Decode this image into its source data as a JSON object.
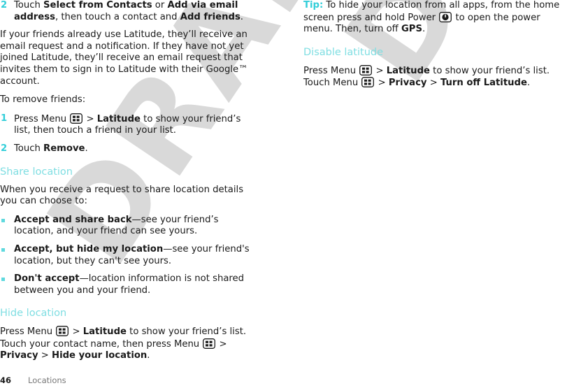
{
  "watermark": {
    "line1": "DRAFT",
    "line2": "DRAFT",
    "color": "#d9d9d9"
  },
  "colors": {
    "heading": "#7fdee2",
    "tip_label": "#32ced9",
    "list_marker": "#32ced9",
    "bullet": "#5fd9de",
    "body_text": "#1a1a1a",
    "footer_chapter": "#777777"
  },
  "icons": {
    "menu": "menu-key-icon",
    "power": "power-key-icon"
  },
  "left_column": {
    "step2": {
      "number": "2",
      "t1": "Touch ",
      "b1": "Select from Contacts",
      "t2": " or ",
      "b2": "Add via email address",
      "t3": ", then touch a contact and ",
      "b3": "Add friends",
      "t4": "."
    },
    "para_latitude_friends": "If your friends already use Latitude, they’ll receive an email request and a notification. If they have not yet joined Latitude, they’ll receive an email request that invites them to sign in to Latitude with their Google™ account.",
    "remove_intro": "To remove friends:",
    "remove_step1": {
      "number": "1",
      "t1": "Press Menu ",
      "t2": " > ",
      "b1": "Latitude",
      "t3": " to show your friend’s list, then touch a friend in your list."
    },
    "remove_step2": {
      "number": "2",
      "t1": "Touch ",
      "b1": "Remove",
      "t2": "."
    },
    "share_heading": "Share location",
    "share_intro": "When you receive a request to share location details you can choose to:",
    "bullets": [
      {
        "bold": "Accept and share back",
        "rest": "—see your friend’s location, and your friend can see yours."
      },
      {
        "bold": "Accept, but hide my location",
        "rest": "—see your friend's location, but they can't see yours."
      },
      {
        "bold": "Don't accept",
        "rest": "—location information is not shared between you and your friend."
      }
    ],
    "hide_heading": "Hide location",
    "hide_body": {
      "t1": "Press Menu ",
      "t2": " > ",
      "b1": "Latitude",
      "t3": " to show your friend’s list. Touch your contact name, then press Menu ",
      "t4": " > ",
      "b2": "Privacy",
      "t5": " > ",
      "b3": "Hide your location",
      "t6": "."
    }
  },
  "right_column": {
    "tip": {
      "label": "Tip:",
      "t1": " To hide your location from all apps, from the home screen press and hold Power ",
      "t2": " to open the power menu. Then, turn off ",
      "b1": "GPS",
      "t3": "."
    },
    "disable_heading": "Disable latitude",
    "disable_body": {
      "t1": "Press Menu ",
      "t2": " > ",
      "b1": "Latitude",
      "t3": " to show your friend’s list. Touch Menu ",
      "t4": " > ",
      "b2": "Privacy",
      "t5": " > ",
      "b3": "Turn off Latitude",
      "t6": "."
    }
  },
  "footer": {
    "page_number": "46",
    "chapter": "Locations"
  }
}
